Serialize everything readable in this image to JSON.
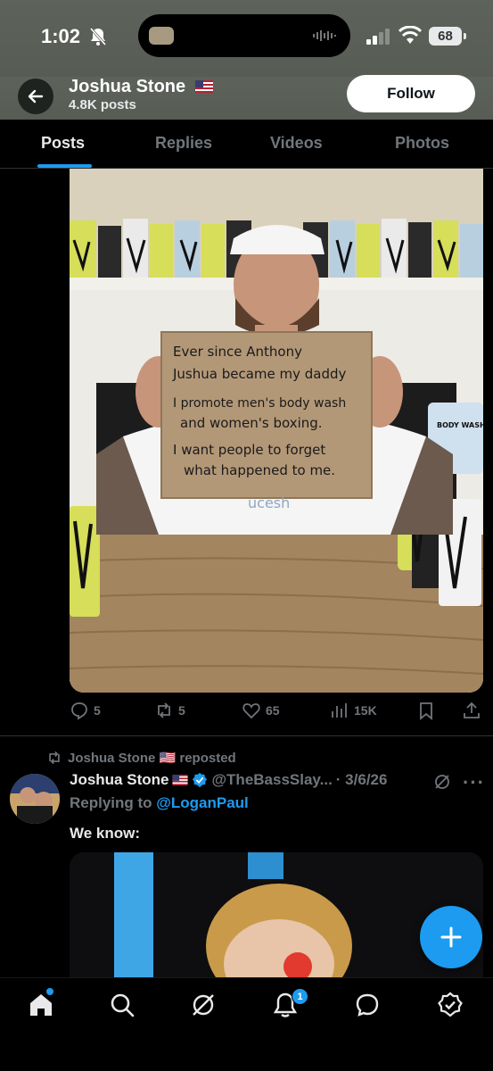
{
  "status_bar": {
    "time": "1:02",
    "battery": "68"
  },
  "header": {
    "name": "Joshua Stone",
    "posts_count": "4.8K posts",
    "follow_label": "Follow"
  },
  "tabs": [
    {
      "label": "Posts",
      "active": true
    },
    {
      "label": "Replies",
      "active": false
    },
    {
      "label": "Videos",
      "active": false
    },
    {
      "label": "Photos",
      "active": false
    }
  ],
  "post1": {
    "sign_lines": [
      "Ever since Anthony",
      "Jushua became my daddy",
      "I promote men's body wash",
      "and women's boxing.",
      "I want people to forget",
      "what happened to me."
    ],
    "product_label": "BODY WASH",
    "shirt_text": "ucesh",
    "actions": {
      "replies": "5",
      "reposts": "5",
      "likes": "65",
      "views": "15K"
    }
  },
  "post2": {
    "repost_label": "Joshua Stone 🇺🇸 reposted",
    "name": "Joshua Stone",
    "handle": "@TheBassSlay...",
    "date": "· 3/6/26",
    "replying_prefix": "Replying to",
    "replying_to": "@LoganPaul",
    "text": "We know:"
  },
  "nav": {
    "notifications_badge": "1"
  },
  "colors": {
    "accent": "#1d9bf0",
    "background": "#000000",
    "secondary_text": "#71767b",
    "header_bg": "#5a5f57"
  }
}
